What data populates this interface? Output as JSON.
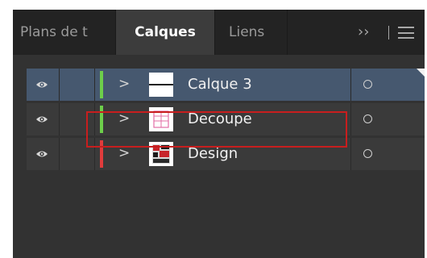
{
  "tabs": {
    "plans_label": "Plans de t",
    "calques_label": "Calques",
    "liens_label": "Liens"
  },
  "menu": {
    "collapse_glyph": "››",
    "menu_icon": "hamburger-icon"
  },
  "layers": [
    {
      "name": "Calque 3",
      "color": "#6dcf4a",
      "selected": true,
      "icons": [
        "eye-icon",
        "chevron-right-icon",
        "target-circle-icon"
      ]
    },
    {
      "name": "Decoupe",
      "color": "#6dcf4a",
      "selected": false,
      "icons": [
        "eye-icon",
        "chevron-right-icon",
        "target-circle-icon"
      ]
    },
    {
      "name": "Design",
      "color": "#e13c3c",
      "selected": false,
      "icons": [
        "eye-icon",
        "chevron-right-icon",
        "target-circle-icon"
      ]
    }
  ],
  "colors": {
    "panel_bg": "#323232",
    "tabbar_bg": "#232323",
    "active_tab_bg": "#3c3c3c",
    "selected_row_bg": "#46586f",
    "row_bg": "#3a3a3a",
    "highlight_border": "#c81e1e"
  }
}
